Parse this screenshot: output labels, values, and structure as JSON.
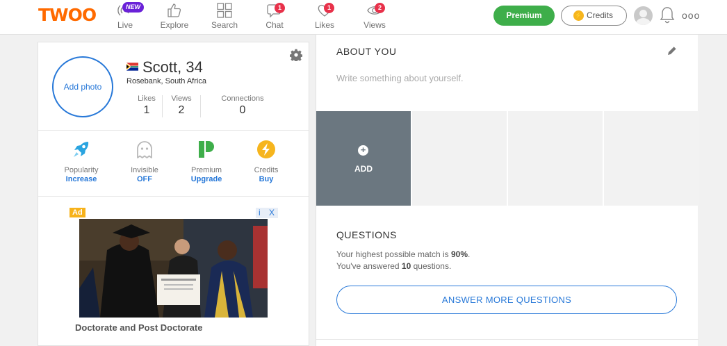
{
  "brand": {
    "logo": "TWOO"
  },
  "nav": {
    "items": [
      {
        "label": "Live",
        "badge": "NEW"
      },
      {
        "label": "Explore"
      },
      {
        "label": "Search"
      },
      {
        "label": "Chat",
        "badge": "1"
      },
      {
        "label": "Likes",
        "badge": "1"
      },
      {
        "label": "Views",
        "badge": "2"
      }
    ],
    "premium_label": "Premium",
    "credits_label": "Credits",
    "more": "ooo"
  },
  "profile": {
    "add_photo": "Add photo",
    "name": "Scott, 34",
    "location": "Rosebank, South Africa",
    "stats": [
      {
        "label": "Likes",
        "value": "1"
      },
      {
        "label": "Views",
        "value": "2"
      },
      {
        "label": "Connections",
        "value": "0"
      }
    ],
    "features": [
      {
        "label": "Popularity",
        "action": "Increase",
        "icon": "rocket-icon"
      },
      {
        "label": "Invisible",
        "action": "OFF",
        "icon": "ghost-icon"
      },
      {
        "label": "Premium",
        "action": "Upgrade",
        "icon": "premium-p-icon"
      },
      {
        "label": "Credits",
        "action": "Buy",
        "icon": "lightning-coin-icon"
      }
    ]
  },
  "ad": {
    "tag": "Ad",
    "info": "i",
    "close": "X",
    "title": "Doctorate and Post Doctorate"
  },
  "about": {
    "title": "ABOUT YOU",
    "placeholder": "Write something about yourself.",
    "add_label": "ADD"
  },
  "questions": {
    "title": "QUESTIONS",
    "match_prefix": "Your highest possible match is ",
    "match_value": "90%",
    "match_suffix": ".",
    "answered_prefix": "You've answered ",
    "answered_value": "10",
    "answered_suffix": " questions.",
    "button": "ANSWER MORE QUESTIONS"
  },
  "colors": {
    "brand_orange": "#ff6a00",
    "premium_green": "#3eae4a",
    "link_blue": "#2778d8",
    "badge_red": "#e8314a",
    "new_purple": "#6a21d8"
  }
}
